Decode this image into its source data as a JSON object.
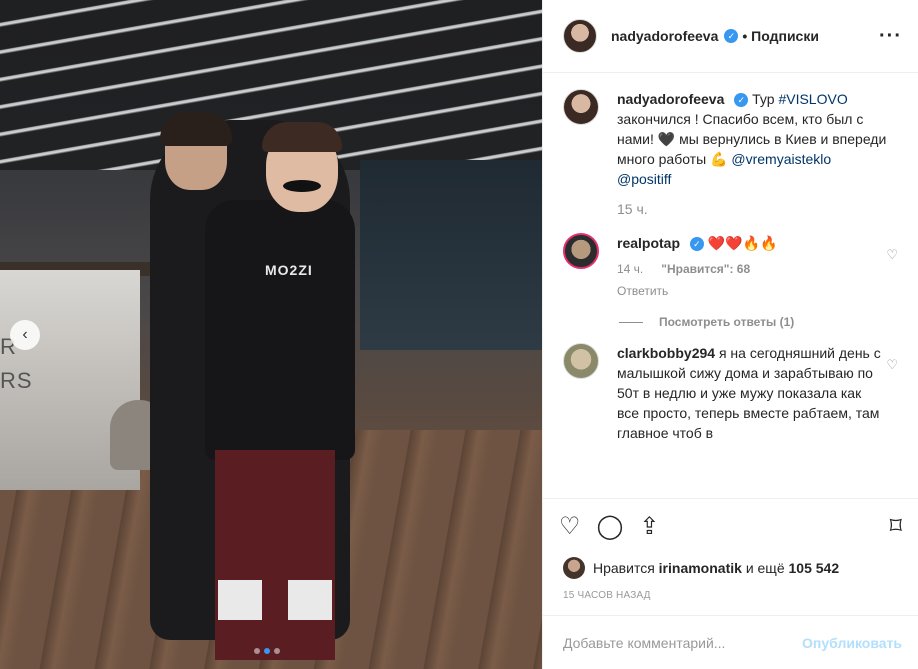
{
  "post": {
    "bar_text": [
      "R",
      "RS"
    ],
    "hoodie_text": "MO2ZI",
    "carousel": {
      "prev_icon": "chevron-left-icon",
      "slides": 3,
      "active_index": 1
    }
  },
  "header": {
    "username": "nadyadorofeeva",
    "verified_icon": "verified-badge-icon",
    "follow_label": "• Подписки",
    "more_icon": "more-icon"
  },
  "caption": {
    "username": "nadyadorofeeva",
    "prefix": "Тур ",
    "hashtag": "#VISLOVO",
    "text1": " закончился ! Спасибо всем, кто был с нами! ",
    "emoji1": "🖤",
    "text2": " мы вернулись в Киев и впереди много работы ",
    "emoji2": "💪",
    "mention1": "@vremyaisteklo",
    "mention2": "@positiff",
    "time": "15 ч."
  },
  "comments": [
    {
      "username": "realpotap",
      "text": "❤️❤️🔥🔥",
      "time": "14 ч.",
      "likes_label": "\"Нравится\": 68",
      "reply_label": "Ответить",
      "view_replies": "Посмотреть ответы (1)"
    },
    {
      "username": "clarkbobby294",
      "text": "я на сегодняшний день с малышкой сижу дома и зарабтываю по 50т в недлю и уже мужу показала как все просто, теперь вместе рабтаем, там главное чтоб в"
    }
  ],
  "actions": {
    "like_icon": "heart-icon",
    "comment_icon": "comment-icon",
    "share_icon": "share-icon",
    "save_icon": "bookmark-icon"
  },
  "likes": {
    "prefix": "Нравится ",
    "user": "irinamonatik",
    "middle": " и ещё ",
    "count": "105 542"
  },
  "timestamp": "15 часов назад",
  "add_comment": {
    "placeholder": "Добавьте комментарий...",
    "post_label": "Опубликовать"
  },
  "colors": {
    "accent": "#3897f0",
    "link": "#003569",
    "muted": "#8e8e8e"
  }
}
